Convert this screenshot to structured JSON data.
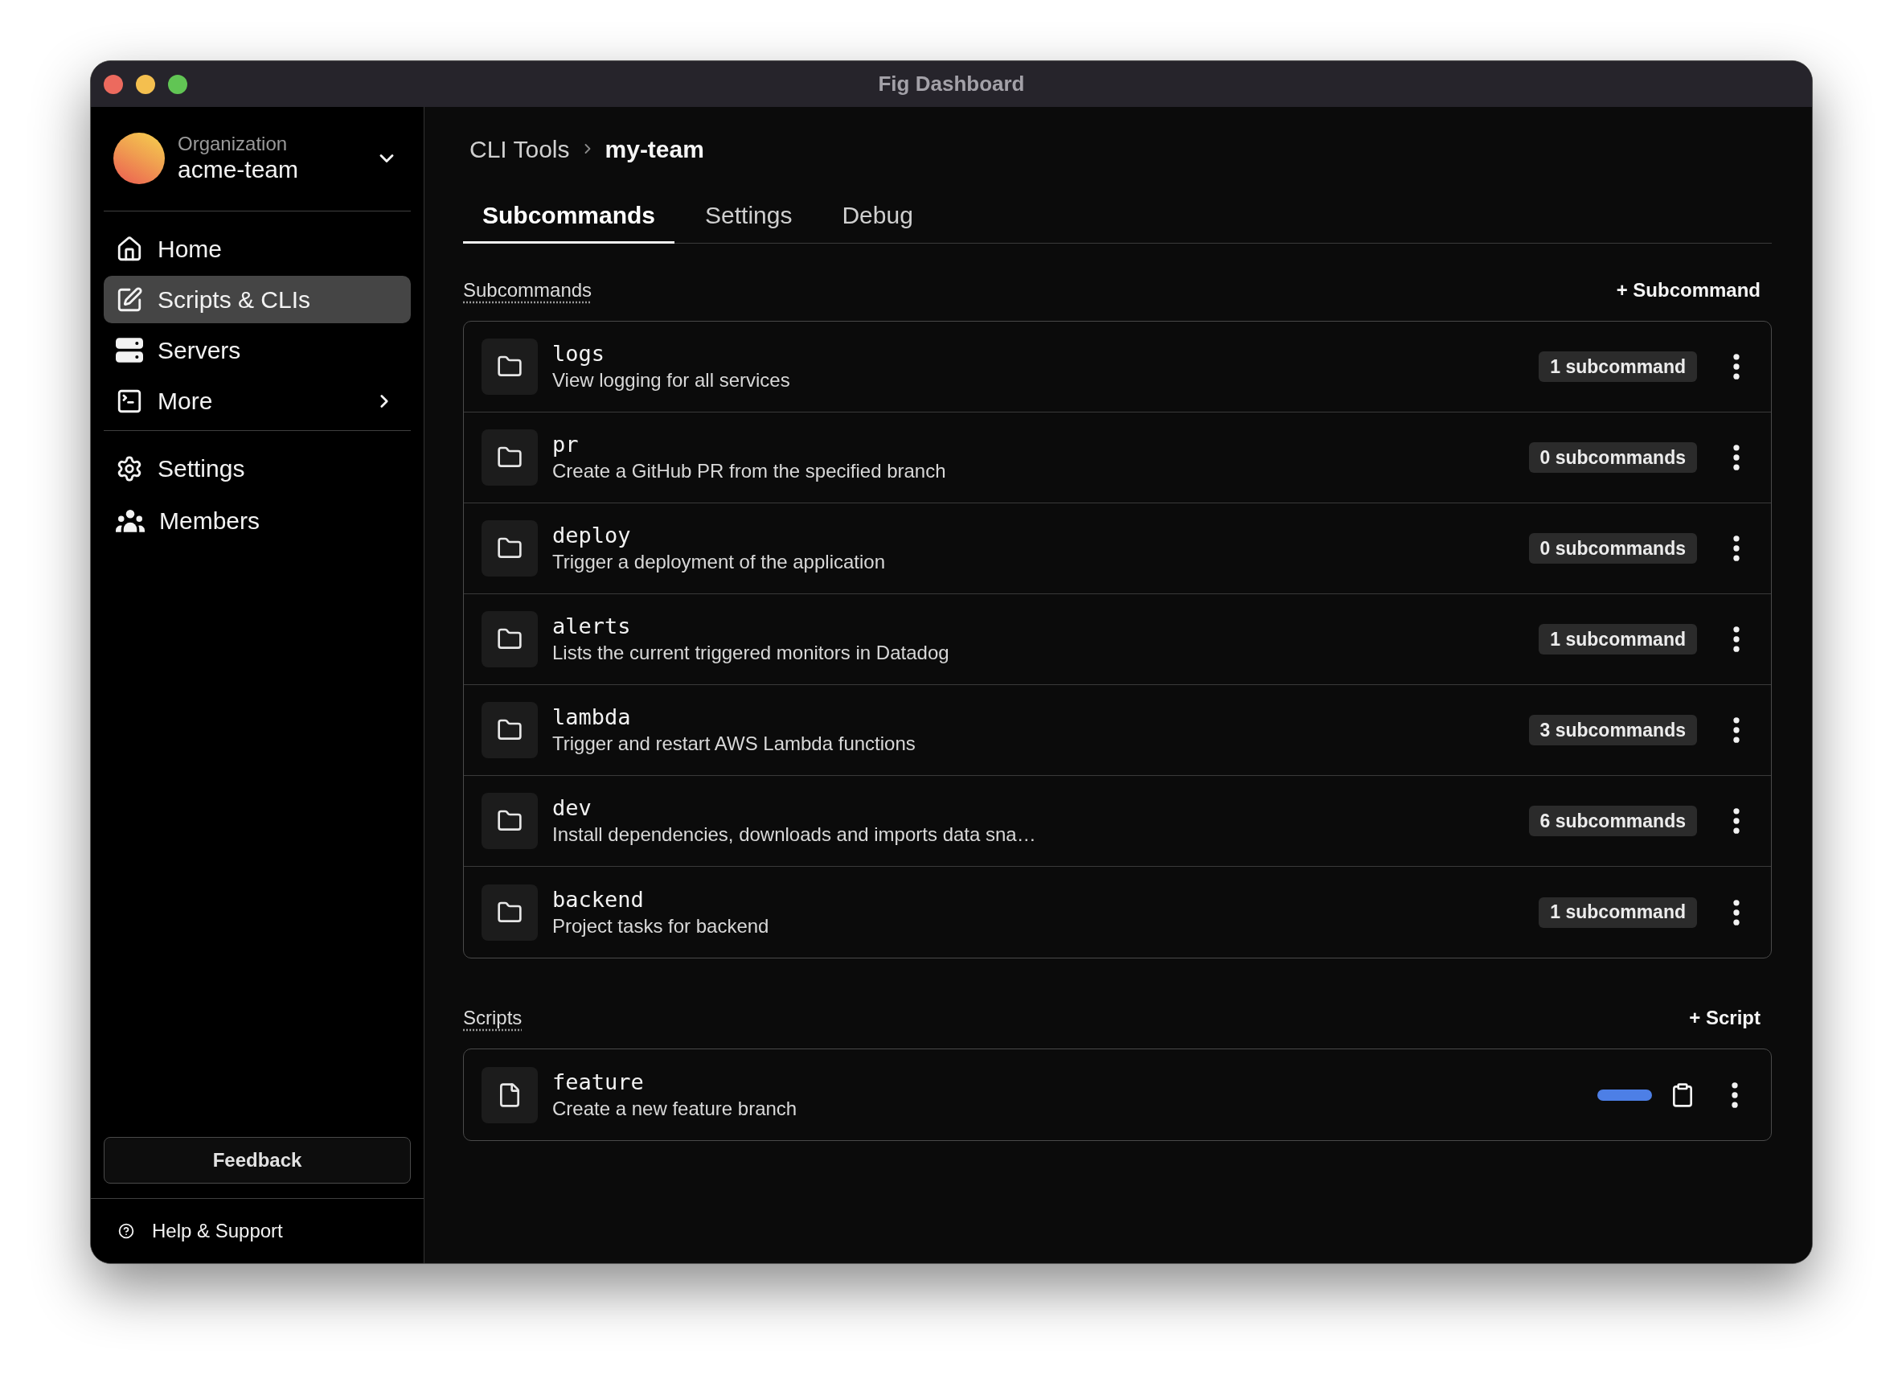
{
  "window": {
    "title": "Fig Dashboard"
  },
  "sidebar": {
    "organization": {
      "label": "Organization",
      "name": "acme-team"
    },
    "nav": [
      {
        "label": "Home",
        "selected": false,
        "submenu": false
      },
      {
        "label": "Scripts & CLIs",
        "selected": true,
        "submenu": false
      },
      {
        "label": "Servers",
        "selected": false,
        "submenu": false
      },
      {
        "label": "More",
        "selected": false,
        "submenu": true
      }
    ],
    "nav_secondary": [
      {
        "label": "Settings",
        "selected": false
      },
      {
        "label": "Members",
        "selected": false
      }
    ],
    "feedback_button": "Feedback",
    "help_link": "Help & Support"
  },
  "breadcrumb": [
    "CLI Tools",
    "my-team"
  ],
  "tabs": [
    {
      "label": "Subcommands",
      "selected": true
    },
    {
      "label": "Settings",
      "selected": false
    },
    {
      "label": "Debug",
      "selected": false
    }
  ],
  "subcommands": {
    "title": "Subcommands",
    "add_button": "+ Subcommand",
    "items": [
      {
        "name": "logs",
        "description": "View logging for all services",
        "count": "1 subcommand"
      },
      {
        "name": "pr",
        "description": "Create a GitHub PR from the specified branch",
        "count": "0 subcommands"
      },
      {
        "name": "deploy",
        "description": "Trigger a deployment of the application",
        "count": "0 subcommands"
      },
      {
        "name": "alerts",
        "description": "Lists the current triggered monitors in Datadog",
        "count": "1 subcommand"
      },
      {
        "name": "lambda",
        "description": "Trigger and restart AWS Lambda functions",
        "count": "3 subcommands"
      },
      {
        "name": "dev",
        "description": "Install dependencies, downloads and imports data sna…",
        "count": "6 subcommands"
      },
      {
        "name": "backend",
        "description": "Project tasks for backend",
        "count": "1 subcommand"
      }
    ]
  },
  "scripts": {
    "title": "Scripts",
    "add_button": "+ Script",
    "items": [
      {
        "name": "feature",
        "description": "Create a new feature branch"
      }
    ]
  }
}
